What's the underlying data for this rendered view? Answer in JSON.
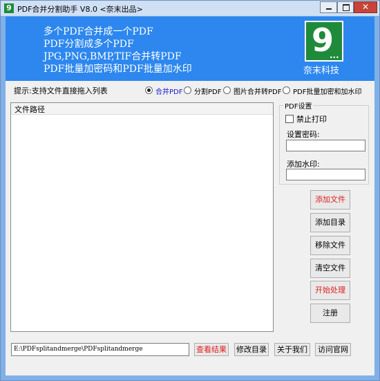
{
  "window": {
    "title": "PDF合并分割助手 V8.0 <奈末出品>",
    "icon_label": "9",
    "controls": {
      "minimize": "minimize-icon",
      "maximize": "maximize-icon",
      "close": "✕"
    }
  },
  "banner": {
    "lines": [
      "多个PDF合并成一个PDF",
      "PDF分割成多个PDF",
      "JPG,PNG,BMP,TIF合并转PDF",
      "PDF批量加密码和PDF批量加水印"
    ],
    "logo_text": "9",
    "logo_dots": "...",
    "brand": "奈末科技",
    "colors": {
      "background": "#2d87ee",
      "logo": "#1f8a3a"
    }
  },
  "hint": "提示:支持文件直接拖入列表",
  "modes": [
    {
      "label": "合并PDF",
      "selected": true
    },
    {
      "label": "分割PDF",
      "selected": false
    },
    {
      "label": "图片合并转PDF",
      "selected": false
    },
    {
      "label": "PDF批量加密和加水印",
      "selected": false
    }
  ],
  "file_list": {
    "column": "文件路径",
    "rows": []
  },
  "pdf_settings": {
    "title": "PDF设置",
    "no_print_label": "禁止打印",
    "no_print_checked": false,
    "password_label": "设置密码:",
    "password_value": "",
    "watermark_label": "添加水印:",
    "watermark_value": ""
  },
  "side_buttons": [
    "添加文件",
    "添加目录",
    "移除文件",
    "清空文件",
    "开始处理",
    "注册"
  ],
  "output_path": "E:\\PDFsplitandmerge\\PDFsplitandmerge",
  "bottom_buttons": [
    "查看结果",
    "修改目录",
    "关于我们",
    "访问官网"
  ]
}
